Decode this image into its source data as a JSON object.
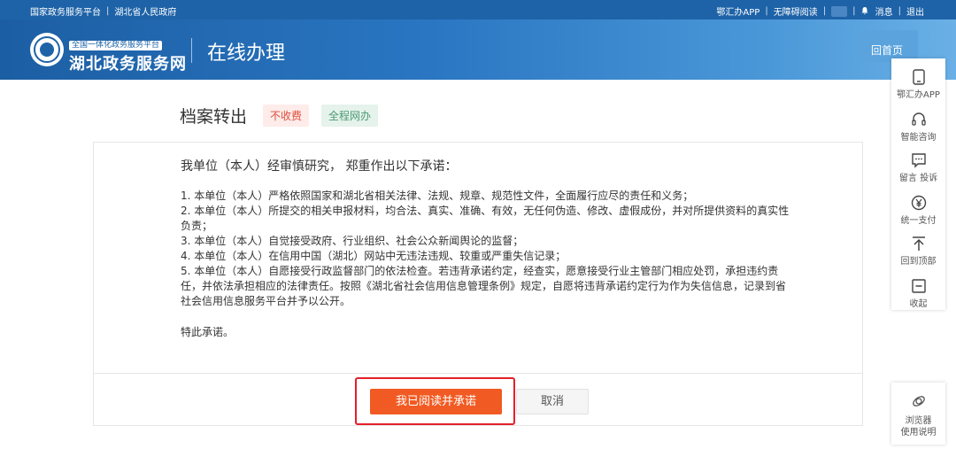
{
  "topbar": {
    "left_links": [
      "国家政务服务平台",
      "湖北省人民政府"
    ],
    "right_links": [
      "鄂汇办APP",
      "无障碍阅读"
    ],
    "message": "消息",
    "logout": "退出"
  },
  "header": {
    "brand_sub": "全国一体化政务服务平台",
    "brand_main": "湖北政务服务网",
    "section_title": "在线办理",
    "home_button": "回首页"
  },
  "page": {
    "title": "档案转出",
    "tags": [
      "不收费",
      "全程网办"
    ]
  },
  "commitment": {
    "intro": "我单位（本人）经审慎研究， 郑重作出以下承诺：",
    "items": [
      "1. 本单位（本人）严格依照国家和湖北省相关法律、法规、规章、规范性文件，全面履行应尽的责任和义务；",
      "2. 本单位（本人）所提交的相关申报材料，均合法、真实、准确、有效，无任何伪造、修改、虚假成份，并对所提供资料的真实性负责；",
      "3. 本单位（本人）自觉接受政府、行业组织、社会公众新闻舆论的监督；",
      "4. 本单位（本人）在信用中国（湖北）网站中无违法违规、较重或严重失信记录；",
      "5. 本单位（本人）自愿接受行政监督部门的依法检查。若违背承诺约定，经查实，愿意接受行业主管部门相应处罚，承担违约责任，并依法承担相应的法律责任。按照《湖北省社会信用信息管理条例》规定，自愿将违背承诺约定行为作为失信信息，记录到省社会信用信息服务平台并予以公开。"
    ],
    "closing": "特此承诺。"
  },
  "actions": {
    "agree": "我已阅读并承诺",
    "cancel": "取消"
  },
  "side_tools": [
    {
      "label": "鄂汇办APP",
      "icon": "phone-icon"
    },
    {
      "label": "智能咨询",
      "icon": "headset-icon"
    },
    {
      "label": "留言 投诉",
      "icon": "message-icon"
    },
    {
      "label": "统一支付",
      "icon": "yen-icon"
    },
    {
      "label": "回到顶部",
      "icon": "back-to-top-icon"
    },
    {
      "label": "收起",
      "icon": "collapse-icon"
    }
  ],
  "browser_guide": {
    "line1": "浏览器",
    "line2": "使用说明",
    "icon": "browser-icon"
  },
  "colors": {
    "primary_blue": "#1e63a8",
    "agree_orange": "#f15a22",
    "highlight_red": "#e4202a",
    "tag_fee": "#e14b3a",
    "tag_online": "#4a9a72"
  }
}
